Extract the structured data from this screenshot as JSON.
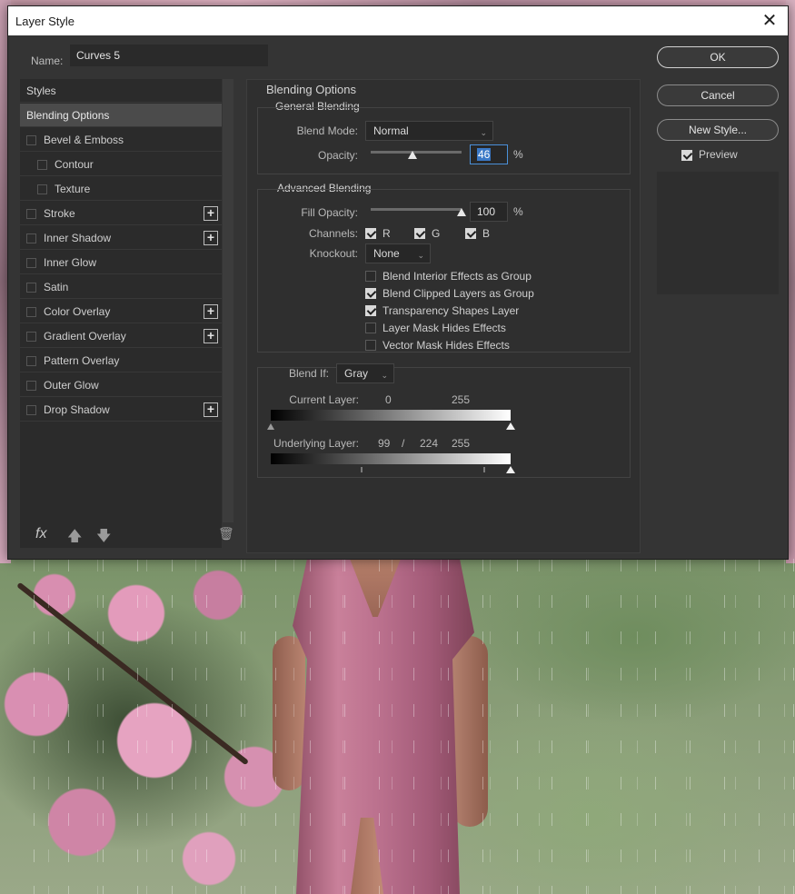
{
  "window": {
    "title": "Layer Style",
    "close_glyph": "✕"
  },
  "name": {
    "label": "Name:",
    "value": "Curves 5"
  },
  "styles": {
    "header": "Styles",
    "items": [
      {
        "label": "Blending Options",
        "active": true,
        "checkbox": false,
        "plus": false,
        "indent": 0
      },
      {
        "label": "Bevel & Emboss",
        "checkbox": true,
        "plus": false,
        "indent": 0
      },
      {
        "label": "Contour",
        "checkbox": true,
        "plus": false,
        "indent": 1
      },
      {
        "label": "Texture",
        "checkbox": true,
        "plus": false,
        "indent": 1
      },
      {
        "label": "Stroke",
        "checkbox": true,
        "plus": true,
        "indent": 0
      },
      {
        "label": "Inner Shadow",
        "checkbox": true,
        "plus": true,
        "indent": 0
      },
      {
        "label": "Inner Glow",
        "checkbox": true,
        "plus": false,
        "indent": 0
      },
      {
        "label": "Satin",
        "checkbox": true,
        "plus": false,
        "indent": 0
      },
      {
        "label": "Color Overlay",
        "checkbox": true,
        "plus": true,
        "indent": 0
      },
      {
        "label": "Gradient Overlay",
        "checkbox": true,
        "plus": true,
        "indent": 0
      },
      {
        "label": "Pattern Overlay",
        "checkbox": true,
        "plus": false,
        "indent": 0
      },
      {
        "label": "Outer Glow",
        "checkbox": true,
        "plus": false,
        "indent": 0
      },
      {
        "label": "Drop Shadow",
        "checkbox": true,
        "plus": true,
        "indent": 0
      }
    ],
    "footer": {
      "fx": "fx",
      "up": "🡅",
      "down": "🡇",
      "trash": "🗑"
    }
  },
  "blending": {
    "title": "Blending Options",
    "general": {
      "title": "General Blending",
      "blend_mode_label": "Blend Mode:",
      "blend_mode": "Normal",
      "opacity_label": "Opacity:",
      "opacity": "46",
      "opacity_fraction": 0.46,
      "pct": "%"
    },
    "advanced": {
      "title": "Advanced Blending",
      "fill_label": "Fill Opacity:",
      "fill": "100",
      "fill_fraction": 1.0,
      "pct": "%",
      "channels_label": "Channels:",
      "channels": [
        {
          "label": "R",
          "checked": true
        },
        {
          "label": "G",
          "checked": true
        },
        {
          "label": "B",
          "checked": true
        }
      ],
      "knockout_label": "Knockout:",
      "knockout": "None",
      "options": [
        {
          "label": "Blend Interior Effects as Group",
          "checked": false
        },
        {
          "label": "Blend Clipped Layers as Group",
          "checked": true
        },
        {
          "label": "Transparency Shapes Layer",
          "checked": true
        },
        {
          "label": "Layer Mask Hides Effects",
          "checked": false
        },
        {
          "label": "Vector Mask Hides Effects",
          "checked": false
        }
      ]
    },
    "blend_if": {
      "label": "Blend If:",
      "value": "Gray",
      "current_label": "Current Layer:",
      "current_low": "0",
      "current_high": "255",
      "underlying_label": "Underlying Layer:",
      "underlying_low": "99",
      "underlying_sep": "/",
      "underlying_mid": "224",
      "underlying_high": "255"
    }
  },
  "buttons": {
    "ok": "OK",
    "cancel": "Cancel",
    "new_style": "New Style..."
  },
  "preview": {
    "label": "Preview",
    "checked": true
  }
}
